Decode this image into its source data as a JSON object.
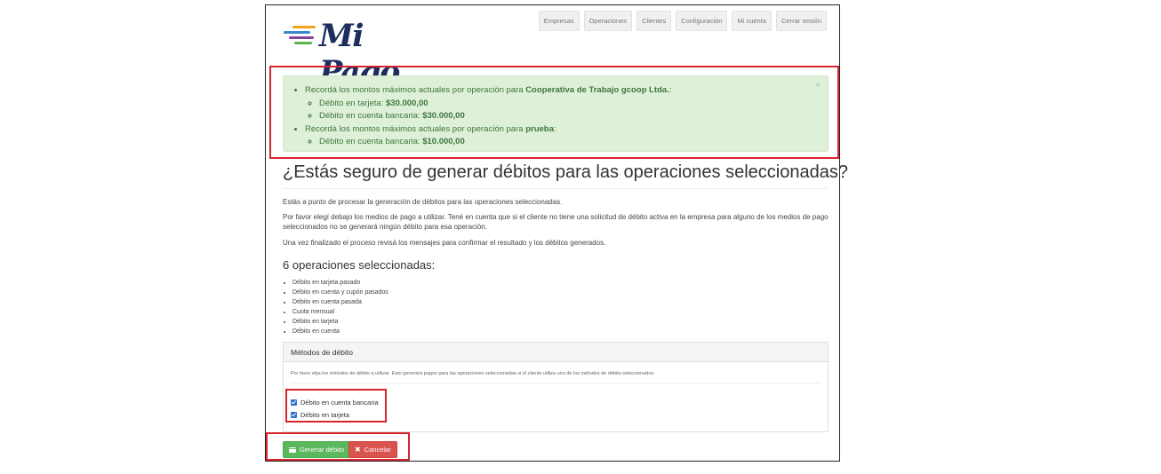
{
  "brand": {
    "name": "Mi Pago",
    "bar_colors": [
      "#f3a21b",
      "#3a87c8",
      "#8a3f96",
      "#5bb548"
    ]
  },
  "nav": {
    "items": [
      "Empresas",
      "Operaciones",
      "Clientes",
      "Configuración",
      "Mi cuenta",
      "Cerrar sesión"
    ]
  },
  "alert": {
    "close": "×",
    "company1": {
      "prefix": "Recordá los montos máximos actuales por operación para ",
      "name": "Cooperativa de Trabajo gcoop Ltda.",
      "suffix": ":",
      "limits": [
        {
          "label": "Débito en tarjeta: ",
          "amount": "$30.000,00"
        },
        {
          "label": "Débito en cuenta bancaria: ",
          "amount": "$30.000,00"
        }
      ]
    },
    "company2": {
      "prefix": "Recordá los montos máximos actuales por operación para ",
      "name": "prueba",
      "suffix": ":",
      "limits": [
        {
          "label": "Débito en cuenta bancaria: ",
          "amount": "$10.000,00"
        }
      ]
    }
  },
  "main": {
    "title": "¿Estás seguro de generar débitos para las operaciones seleccionadas?",
    "paragraph1": "Estás a punto de procesar la generación de débitos para las operaciones seleccionadas.",
    "paragraph2": "Por favor elegí debajo los medios de pago a utilizar. Tené en cuenta que si el cliente no tiene una solicitud de débito activa en la empresa para alguno de los medios de pago seleccionados no se generará ningún débito para esa operación.",
    "paragraph3": "Una vez finalizado el proceso revisá los mensajes para confirmar el resultado y los débitos generados.",
    "selected_heading": "6 operaciones seleccionadas:",
    "operations": [
      "Débito en tarjeta pasado",
      "Débito en cuenta y cupón pasados",
      "Débito en cuenta pasada",
      "Cuota mensual",
      "Débito en tarjeta",
      "Débito en cuenta"
    ]
  },
  "panel": {
    "title": "Métodos de débito",
    "description": "Por favor elija los métodos de débito a utilizar. Esto generará pagos para las operaciones seleccionadas si el cliente utiliza uno de los métodos de débito seleccionados.",
    "options": [
      {
        "label": "Débito en cuenta bancaria",
        "checked": true
      },
      {
        "label": "Débito en tarjeta",
        "checked": true
      }
    ]
  },
  "actions": {
    "generate_label": "Generar débito",
    "cancel_label": "Cancelar",
    "cancel_icon": "✖"
  },
  "colors": {
    "highlight": "#d9232d",
    "success_bg": "#dff0d8",
    "success_text": "#3c763d",
    "checkbox": "#2a6ed0"
  }
}
